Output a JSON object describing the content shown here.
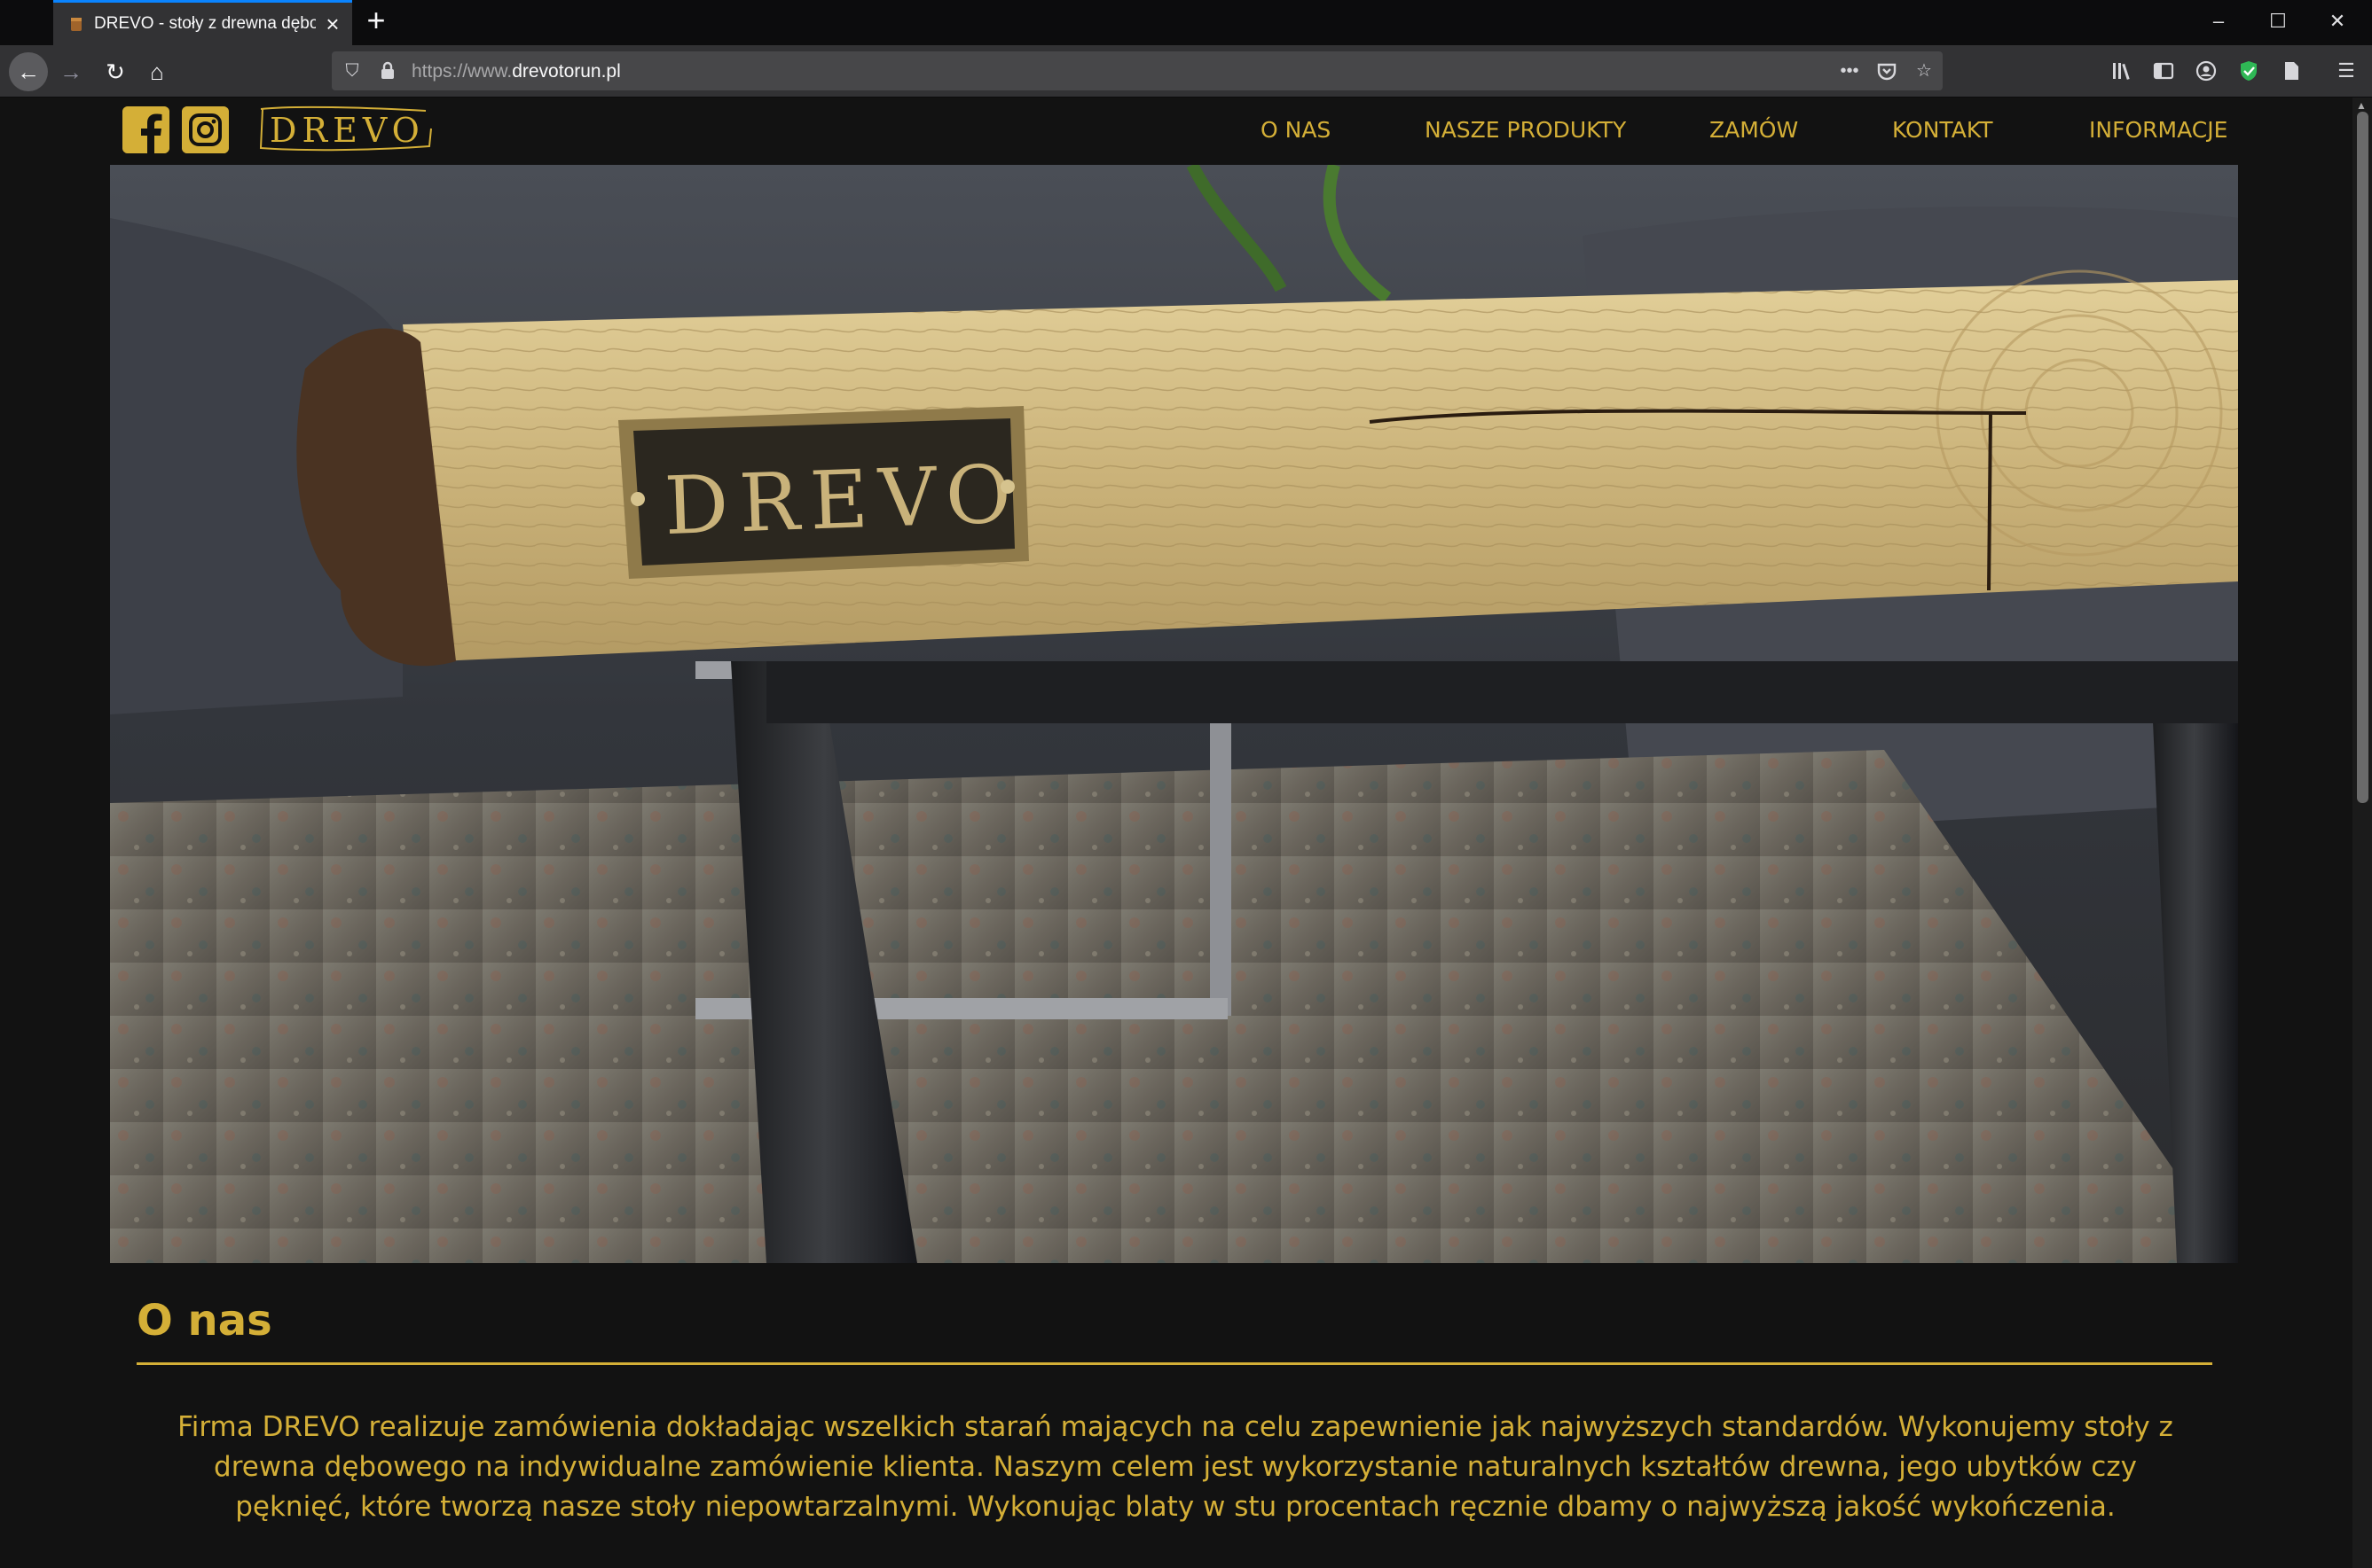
{
  "browser": {
    "tab_title": "DREVO - stoły z drewna dębowego",
    "url_prefix": "https://www.",
    "url_domain": "drevotorun.pl",
    "accent": "#0a84ff"
  },
  "site": {
    "brand_color": "#d4af37",
    "logo_text": "DREVO",
    "social": [
      "facebook-icon",
      "instagram-icon"
    ],
    "menu": [
      "O NAS",
      "NASZE PRODUKTY",
      "ZAMÓW",
      "KONTAKT",
      "INFORMACJE"
    ],
    "hero_plate_text": "DREVO",
    "about": {
      "heading": "O nas",
      "text": "Firma DREVO realizuje zamówienia dokładając wszelkich starań mających na celu zapewnienie jak najwyższych standardów. Wykonujemy stoły z drewna dębowego na indywidualne zamówienie klienta. Naszym celem jest wykorzystanie naturalnych kształtów drewna, jego ubytków czy pęknięć, które tworzą nasze stoły niepowtarzalnymi. Wykonując blaty w stu procentach ręcznie dbamy o najwyższą jakość wykończenia."
    }
  }
}
